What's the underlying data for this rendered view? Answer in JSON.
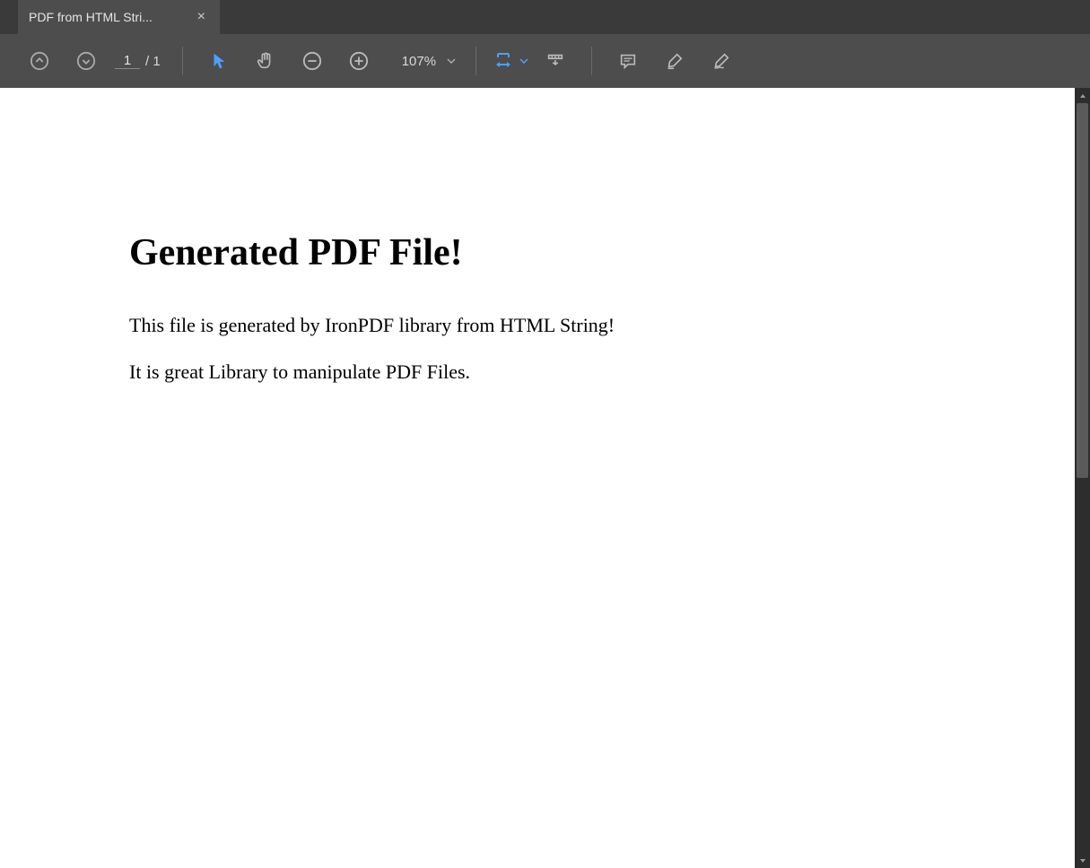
{
  "tab": {
    "title": "PDF from HTML Stri...",
    "close_symbol": "×"
  },
  "toolbar": {
    "page_current": "1",
    "page_total": "/ 1",
    "zoom_level": "107%",
    "accent_color": "#4da0ff"
  },
  "document": {
    "heading": "Generated PDF File!",
    "paragraph1": "This file is generated by IronPDF library from HTML String!",
    "paragraph2": "It is great Library to manipulate PDF Files."
  }
}
